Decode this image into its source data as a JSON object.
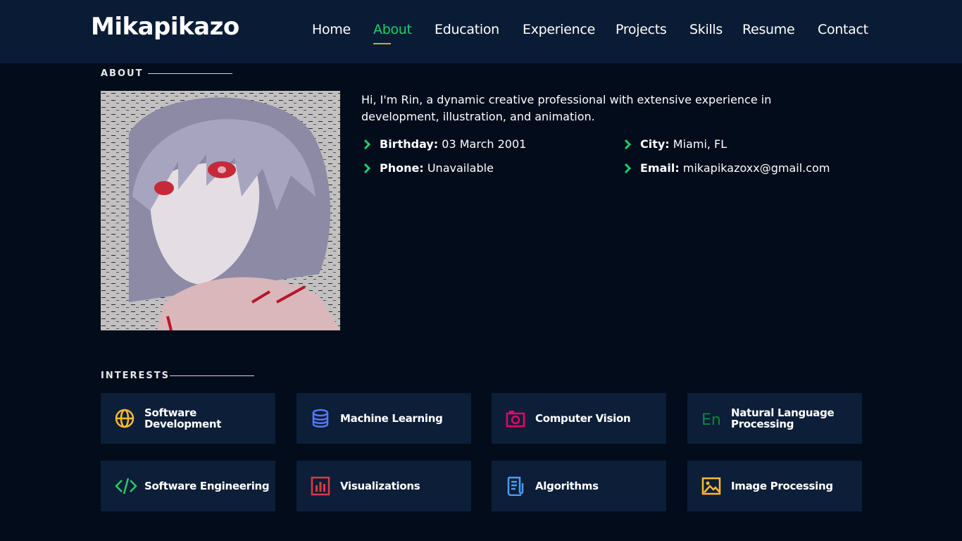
{
  "header": {
    "logo": "Mikapikazo",
    "nav": [
      {
        "label": "Home"
      },
      {
        "label": "About"
      },
      {
        "label": "Education"
      },
      {
        "label": "Experience"
      },
      {
        "label": "Projects"
      },
      {
        "label": "Skills"
      },
      {
        "label": "Resume"
      },
      {
        "label": "Contact"
      }
    ],
    "active_nav": "About"
  },
  "about": {
    "title": "ABOUT",
    "bio": "Hi, I'm Rin, a dynamic creative professional with extensive experience in development, illustration, and animation.",
    "info": [
      {
        "label": "Birthday:",
        "value": "03 March 2001"
      },
      {
        "label": "City:",
        "value": "Miami, FL"
      },
      {
        "label": "Phone:",
        "value": "Unavailable"
      },
      {
        "label": "Email:",
        "value": "mikapikazoxx@gmail.com"
      }
    ]
  },
  "interests": {
    "title": "INTERESTS",
    "items": [
      {
        "label": "Software Development",
        "icon": "globe-icon",
        "color": "#ffbb2c"
      },
      {
        "label": "Machine Learning",
        "icon": "database-icon",
        "color": "#5578ff"
      },
      {
        "label": "Computer Vision",
        "icon": "camera-icon",
        "color": "#e80368"
      },
      {
        "label": "Natural Language Processing",
        "icon": "translate-icon",
        "color": "#11823b"
      },
      {
        "label": "Software Engineering",
        "icon": "code-icon",
        "color": "#29cc61"
      },
      {
        "label": "Visualizations",
        "icon": "bar-chart-icon",
        "color": "#e2374c"
      },
      {
        "label": "Algorithms",
        "icon": "document-icon",
        "color": "#4a9df8"
      },
      {
        "label": "Image Processing",
        "icon": "image-icon",
        "color": "#ffa76e"
      }
    ]
  },
  "colors": {
    "accent": "#18d26e",
    "header_bg": "#0a1c35",
    "page_bg": "#020c1b",
    "card_bg": "#0c1e38"
  }
}
